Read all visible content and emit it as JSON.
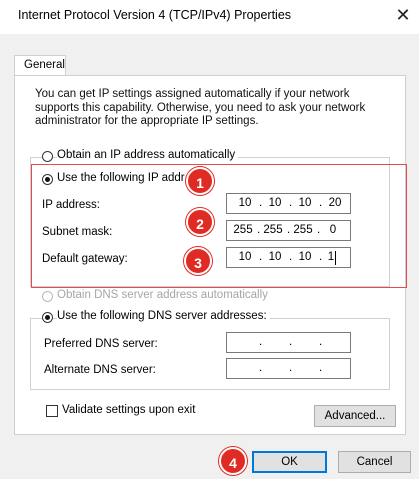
{
  "window": {
    "title": "Internet Protocol Version 4 (TCP/IPv4) Properties",
    "close_glyph": "✕"
  },
  "tabs": [
    {
      "label": "General"
    }
  ],
  "intro_text": "You can get IP settings assigned automatically if your network supports this capability. Otherwise, you need to ask your network administrator for the appropriate IP settings.",
  "ip_section": {
    "auto_label": "Obtain an IP address automatically",
    "manual_label": "Use the following IP addr",
    "auto_selected": false,
    "manual_selected": true,
    "ip_address": {
      "label": "IP address:",
      "octets": [
        "10",
        "10",
        "10",
        "20"
      ]
    },
    "subnet_mask": {
      "label": "Subnet mask:",
      "octets": [
        "255",
        "255",
        "255",
        "0"
      ]
    },
    "default_gateway": {
      "label": "Default gateway:",
      "octets": [
        "10",
        "10",
        "10",
        "1"
      ]
    }
  },
  "dns_section": {
    "auto_label": "Obtain DNS server address automatically",
    "manual_label": "Use the following DNS server addresses:",
    "auto_selected": false,
    "manual_selected": true,
    "preferred": {
      "label": "Preferred DNS server:",
      "octets": [
        "",
        "",
        "",
        ""
      ]
    },
    "alternate": {
      "label": "Alternate DNS server:",
      "octets": [
        "",
        "",
        "",
        ""
      ]
    }
  },
  "validate_label": "Validate settings upon exit",
  "validate_checked": false,
  "buttons": {
    "advanced": "Advanced...",
    "ok": "OK",
    "cancel": "Cancel"
  },
  "annotations": {
    "badge1": "1",
    "badge2": "2",
    "badge3": "3",
    "badge4": "4"
  },
  "colors": {
    "annotation_red": "#e02b24",
    "highlight_border": "#e74c4c",
    "focus_blue": "#0078d7"
  }
}
